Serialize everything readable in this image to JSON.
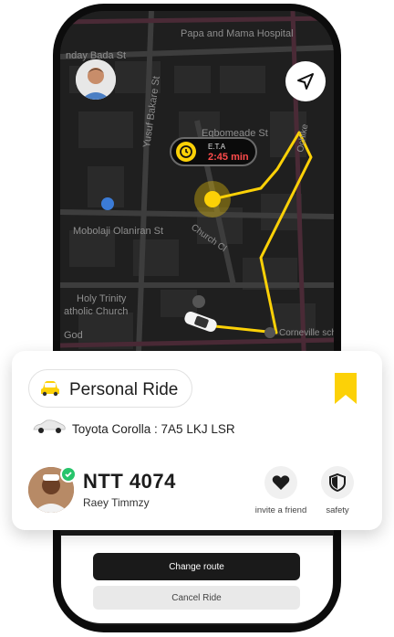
{
  "map": {
    "labels": {
      "top": "Papa and Mama Hospital",
      "bada": "nday Bada St",
      "yusuf": "Yusuf Bakare St",
      "egbomeade": "Egbomeade St",
      "ochike": "Ochike",
      "mobolaji": "Mobolaji Olaniran St",
      "church": "Church Cl",
      "holy1": "Holy Trinity",
      "holy2": "atholic Church",
      "god": "God",
      "cornerville": "Corneville scho"
    },
    "eta": {
      "label": "E.T.A",
      "value": "2:45 min"
    },
    "colors": {
      "route": "#fcd107",
      "background": "#1f1f1f"
    }
  },
  "ride": {
    "type_label": "Personal Ride",
    "car_label": "Toyota Corolla : 7A5 LKJ LSR"
  },
  "driver": {
    "plate": "NTT 4074",
    "name": "Raey Timmzy"
  },
  "actions": [
    {
      "label": "invite a friend",
      "icon": "heart-icon"
    },
    {
      "label": "safety",
      "icon": "shield-icon"
    }
  ],
  "buttons": {
    "change_route": "Change route",
    "cancel": "Cancel Ride"
  },
  "colors": {
    "accent": "#fcd107",
    "verified": "#27c46b"
  }
}
